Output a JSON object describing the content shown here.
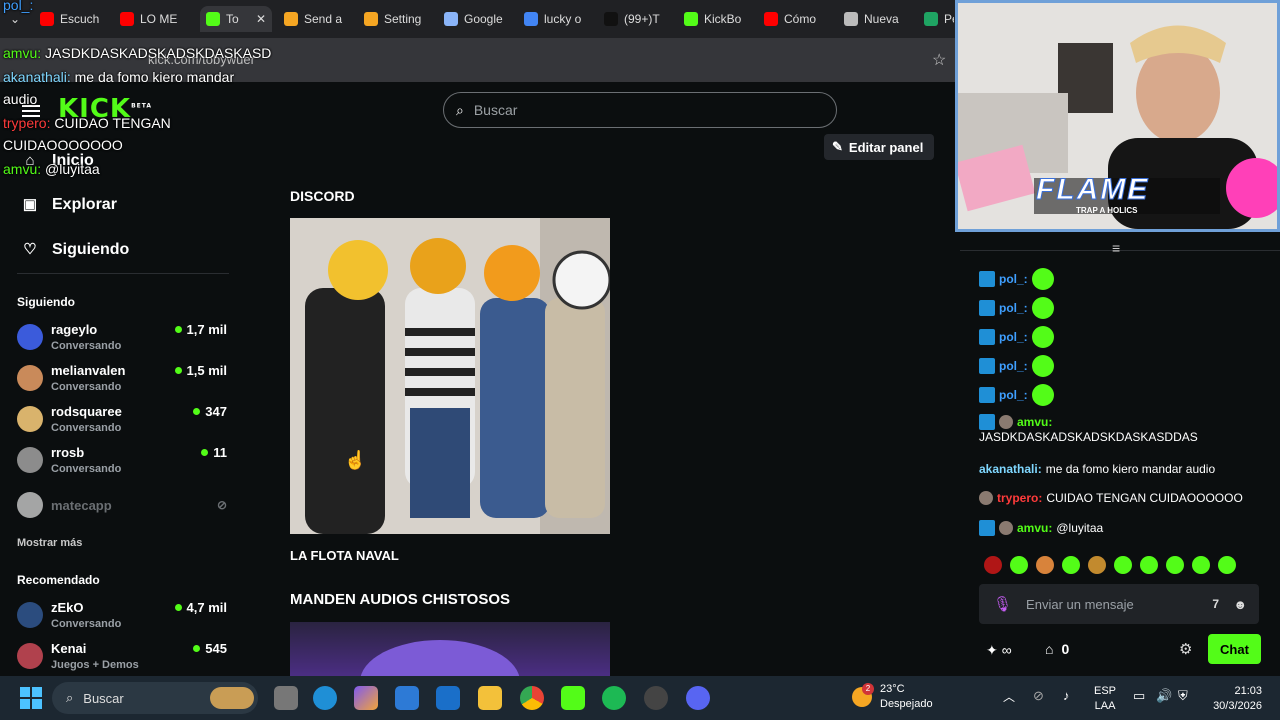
{
  "browser": {
    "tabs": [
      {
        "label": "Escuch",
        "color": "#ff0000"
      },
      {
        "label": "LO ME",
        "color": "#ff0000"
      },
      {
        "label": "To",
        "color": "#53fc18",
        "active": true
      },
      {
        "label": "Send a",
        "color": "#f5a623"
      },
      {
        "label": "Setting",
        "color": "#f5a623"
      },
      {
        "label": "Google",
        "color": "#8ab4f8"
      },
      {
        "label": "lucky o",
        "color": "#4285f4"
      },
      {
        "label": "(99+)T",
        "color": "#111111"
      },
      {
        "label": "KickBo",
        "color": "#53fc18"
      },
      {
        "label": "Cómo",
        "color": "#ff0000"
      },
      {
        "label": "Nueva",
        "color": "#bbbbbb"
      },
      {
        "label": "Pe",
        "color": "#1fa463"
      }
    ],
    "url": "kick.com/tobywuer"
  },
  "overlay_chat": [
    {
      "user": "pol_:",
      "text": "",
      "user_color": "#3f9fff"
    },
    {
      "user": "amvu:",
      "text": " JASDKDASKADSKADSKDASKASD",
      "user_color": "#53fc18"
    },
    {
      "user": "akanathali:",
      "text": " me da fomo kiero mandar",
      "user_color": "#7fd7ff"
    },
    {
      "user": "",
      "text": "audio",
      "user_color": "#ffffff"
    },
    {
      "user": "trypero:",
      "text": " CUIDAO TENGAN",
      "user_color": "#ff3b3b"
    },
    {
      "user": "",
      "text": "CUIDAOOOOOOO",
      "user_color": "#ffffff"
    },
    {
      "user": "amvu:",
      "text": " @luyitaa",
      "user_color": "#53fc18"
    }
  ],
  "header": {
    "search_placeholder": "Buscar",
    "edit_panel": "Editar panel",
    "logo": "KICK",
    "beta": "BETA"
  },
  "nav": {
    "inicio": "Inicio",
    "explorar": "Explorar",
    "siguiendo": "Siguiendo"
  },
  "following": {
    "title": "Siguiendo",
    "items": [
      {
        "name": "rageylo",
        "status": "Conversando",
        "viewers": "1,7 mil",
        "color": "#3b5bdb"
      },
      {
        "name": "melianvalen",
        "status": "Conversando",
        "viewers": "1,5 mil",
        "color": "#c98a5a"
      },
      {
        "name": "rodsquaree",
        "status": "Conversando",
        "viewers": "347",
        "color": "#d9b36c"
      },
      {
        "name": "rrosb",
        "status": "Conversando",
        "viewers": "11",
        "color": "#8c8c8c"
      }
    ],
    "offline": "matecapp",
    "show_more": "Mostrar más"
  },
  "recommended": {
    "title": "Recomendado",
    "items": [
      {
        "name": "zEkO",
        "status": "Conversando",
        "viewers": "4,7 mil",
        "color": "#2b4c7e"
      },
      {
        "name": "Kenai",
        "status": "Juegos + Demos",
        "viewers": "545",
        "color": "#b0414d"
      }
    ]
  },
  "panels": [
    {
      "title": "DISCORD",
      "caption": "LA FLOTA NAVAL"
    },
    {
      "title": "MANDEN AUDIOS CHISTOSOS",
      "caption": ""
    }
  ],
  "stream": {
    "overlay_text": "FLAME",
    "overlay_sub": "TRAP A HOLICS"
  },
  "chat": {
    "messages": [
      {
        "user": "pol_:",
        "text": "",
        "type": "blue",
        "emote": true
      },
      {
        "user": "pol_:",
        "text": "",
        "type": "blue",
        "emote": true
      },
      {
        "user": "pol_:",
        "text": "",
        "type": "blue",
        "emote": true
      },
      {
        "user": "pol_:",
        "text": "",
        "type": "blue",
        "emote": true
      },
      {
        "user": "pol_:",
        "text": "",
        "type": "blue",
        "emote": true
      },
      {
        "user": "amvu:",
        "text": "JASDKDASKADSKADSKDASKASDDAS",
        "type": "green",
        "emote": false
      },
      {
        "user": "akanathali:",
        "text": "me da fomo kiero mandar audio",
        "type": "cyan",
        "emote": false
      },
      {
        "user": "trypero:",
        "text": "CUIDAO TENGAN CUIDAOOOOOO",
        "type": "red",
        "emote": false
      },
      {
        "user": "amvu:",
        "text": "@luyitaa",
        "type": "green",
        "emote": false
      }
    ],
    "input_placeholder": "Enviar un mensaje",
    "points": "0",
    "send_button": "Chat"
  },
  "taskbar": {
    "search": "Buscar",
    "weather_temp": "23°C",
    "weather_desc": "Despejado",
    "lang1": "ESP",
    "lang2": "LAA",
    "time": "21:03",
    "date": "30/3/2026",
    "notif_count": "2"
  }
}
